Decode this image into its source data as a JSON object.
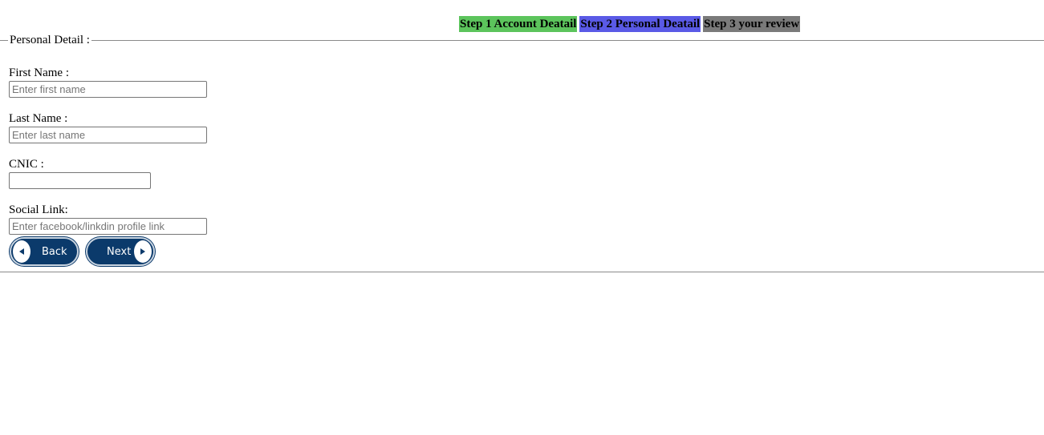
{
  "steps": [
    {
      "label": "Step 1 Account Deatail",
      "color": "#5cc45c"
    },
    {
      "label": "Step 2 Personal Deatail",
      "color": "#5a5ae6"
    },
    {
      "label": "Step 3 your review",
      "color": "#7a7a7a"
    }
  ],
  "section": {
    "legend": "Personal Detail :"
  },
  "form": {
    "first_name": {
      "label": "First Name :",
      "placeholder": "Enter first name",
      "value": ""
    },
    "last_name": {
      "label": "Last Name :",
      "placeholder": "Enter last name",
      "value": ""
    },
    "cnic": {
      "label": "CNIC :",
      "placeholder": "",
      "value": ""
    },
    "social_link": {
      "label": "Social Link:",
      "placeholder": "Enter facebook/linkdin profile link",
      "value": ""
    }
  },
  "buttons": {
    "back": {
      "label": "Back",
      "icon": "arrow-left-icon"
    },
    "next": {
      "label": "Next",
      "icon": "arrow-right-icon"
    }
  },
  "colors": {
    "button_bg": "#0b3a6b"
  }
}
